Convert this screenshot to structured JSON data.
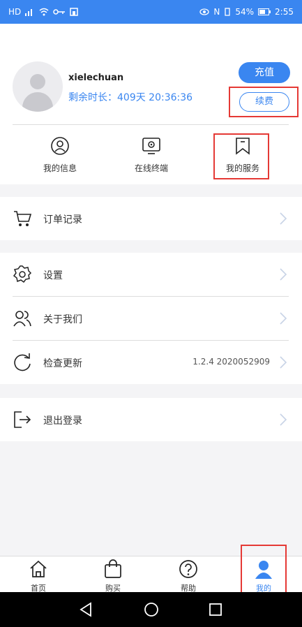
{
  "status_bar": {
    "left_icons": [
      "hd-icon",
      "signal-icon",
      "wifi-icon",
      "key-icon",
      "app-icon"
    ],
    "battery": "54%",
    "time": "2:55"
  },
  "profile": {
    "username": "xielechuan",
    "remaining_time": "剩余时长：409天 20:36:36",
    "recharge_label": "充值",
    "renew_label": "续费"
  },
  "shortcuts": [
    {
      "label": "我的信息",
      "icon": "user-circle-icon"
    },
    {
      "label": "在线终端",
      "icon": "terminal-icon"
    },
    {
      "label": "我的服务",
      "icon": "bookmark-icon"
    }
  ],
  "menu": {
    "orders": {
      "label": "订单记录",
      "icon": "cart-icon"
    },
    "settings": {
      "label": "设置",
      "icon": "gear-icon"
    },
    "about": {
      "label": "关于我们",
      "icon": "users-icon"
    },
    "update": {
      "label": "检查更新",
      "value": "1.2.4 2020052909",
      "icon": "refresh-icon"
    },
    "logout": {
      "label": "退出登录",
      "icon": "logout-icon"
    }
  },
  "tabs": [
    {
      "label": "首页",
      "icon": "home-icon"
    },
    {
      "label": "购买",
      "icon": "shopping-bag-icon"
    },
    {
      "label": "帮助",
      "icon": "help-icon"
    },
    {
      "label": "我的",
      "icon": "person-icon",
      "active": true
    }
  ],
  "colors": {
    "accent": "#3a86f0",
    "highlight": "#e53935"
  }
}
